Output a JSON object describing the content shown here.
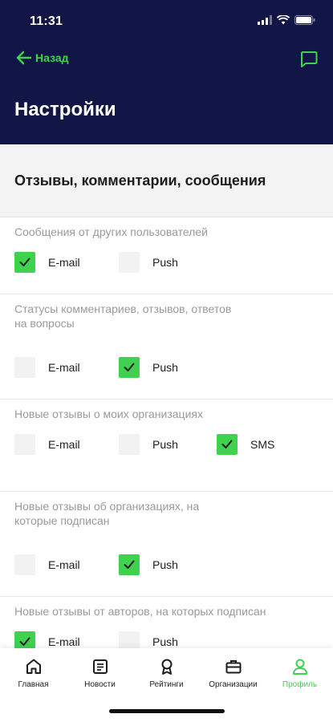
{
  "status": {
    "time": "11:31"
  },
  "nav": {
    "back_label": "Назад"
  },
  "page": {
    "title": "Настройки"
  },
  "section": {
    "title": "Отзывы, комментарии, сообщения"
  },
  "groups": [
    {
      "label_lines": [
        "Сообщения от других пользователей"
      ],
      "options": [
        {
          "label": "E-mail",
          "checked": true
        },
        {
          "label": "Push",
          "checked": false
        }
      ]
    },
    {
      "label_lines": [
        "Статусы комментариев, отзывов, ответов",
        "на вопросы"
      ],
      "options": [
        {
          "label": "E-mail",
          "checked": false
        },
        {
          "label": "Push",
          "checked": true
        }
      ]
    },
    {
      "label_lines": [
        "Новые отзывы о моих организациях"
      ],
      "options": [
        {
          "label": "E-mail",
          "checked": false
        },
        {
          "label": "Push",
          "checked": false
        },
        {
          "label": "SMS",
          "checked": true
        }
      ]
    },
    {
      "label_lines": [
        "Новые отзывы об организациях, на",
        "которые подписан"
      ],
      "options": [
        {
          "label": "E-mail",
          "checked": false
        },
        {
          "label": "Push",
          "checked": true
        }
      ]
    },
    {
      "label_lines": [
        "Новые отзывы от авторов, на которых подписан"
      ],
      "options": [
        {
          "label": "E-mail",
          "checked": true
        },
        {
          "label": "Push",
          "checked": false
        }
      ]
    }
  ],
  "tabs": [
    {
      "label": "Главная",
      "icon": "home-icon",
      "active": false
    },
    {
      "label": "Новости",
      "icon": "news-icon",
      "active": false
    },
    {
      "label": "Рейтинги",
      "icon": "award-icon",
      "active": false
    },
    {
      "label": "Организации",
      "icon": "briefcase-icon",
      "active": false
    },
    {
      "label": "Профиль",
      "icon": "profile-icon",
      "active": true
    }
  ],
  "colors": {
    "header_bg": "#121647",
    "accent": "#3fd24f",
    "band_bg": "#f3f3f3",
    "label_gray": "#9a9a9a"
  }
}
